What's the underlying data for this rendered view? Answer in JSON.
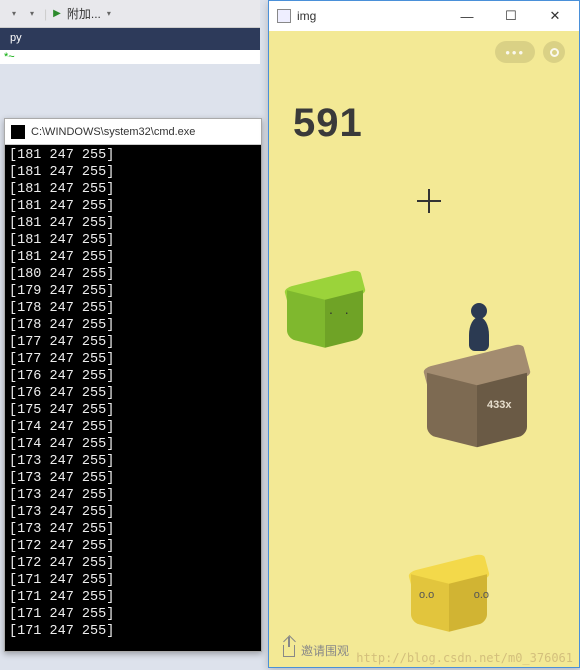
{
  "vs": {
    "attach_label": "附加...",
    "tab_suffix": "py",
    "green_marker": "*~"
  },
  "cmd": {
    "title": "C:\\WINDOWS\\system32\\cmd.exe",
    "rows": [
      "[181 247 255]",
      "[181 247 255]",
      "[181 247 255]",
      "[181 247 255]",
      "[181 247 255]",
      "[181 247 255]",
      "[181 247 255]",
      "[180 247 255]",
      "[179 247 255]",
      "[178 247 255]",
      "[178 247 255]",
      "[177 247 255]",
      "[177 247 255]",
      "[176 247 255]",
      "[176 247 255]",
      "[175 247 255]",
      "[174 247 255]",
      "[174 247 255]",
      "[173 247 255]",
      "[173 247 255]",
      "[173 247 255]",
      "[173 247 255]",
      "[173 247 255]",
      "[172 247 255]",
      "[172 247 255]",
      "[171 247 255]",
      "[171 247 255]",
      "[171 247 255]",
      "[171 247 255]"
    ]
  },
  "img_window": {
    "title": "img",
    "minimize": "—",
    "maximize": "☐",
    "close": "✕"
  },
  "game": {
    "score": "591",
    "menu_dots": "•••",
    "brown_badge": "433x",
    "invite_label": "邀请围观"
  },
  "watermark": "http://blog.csdn.net/m0_376061"
}
